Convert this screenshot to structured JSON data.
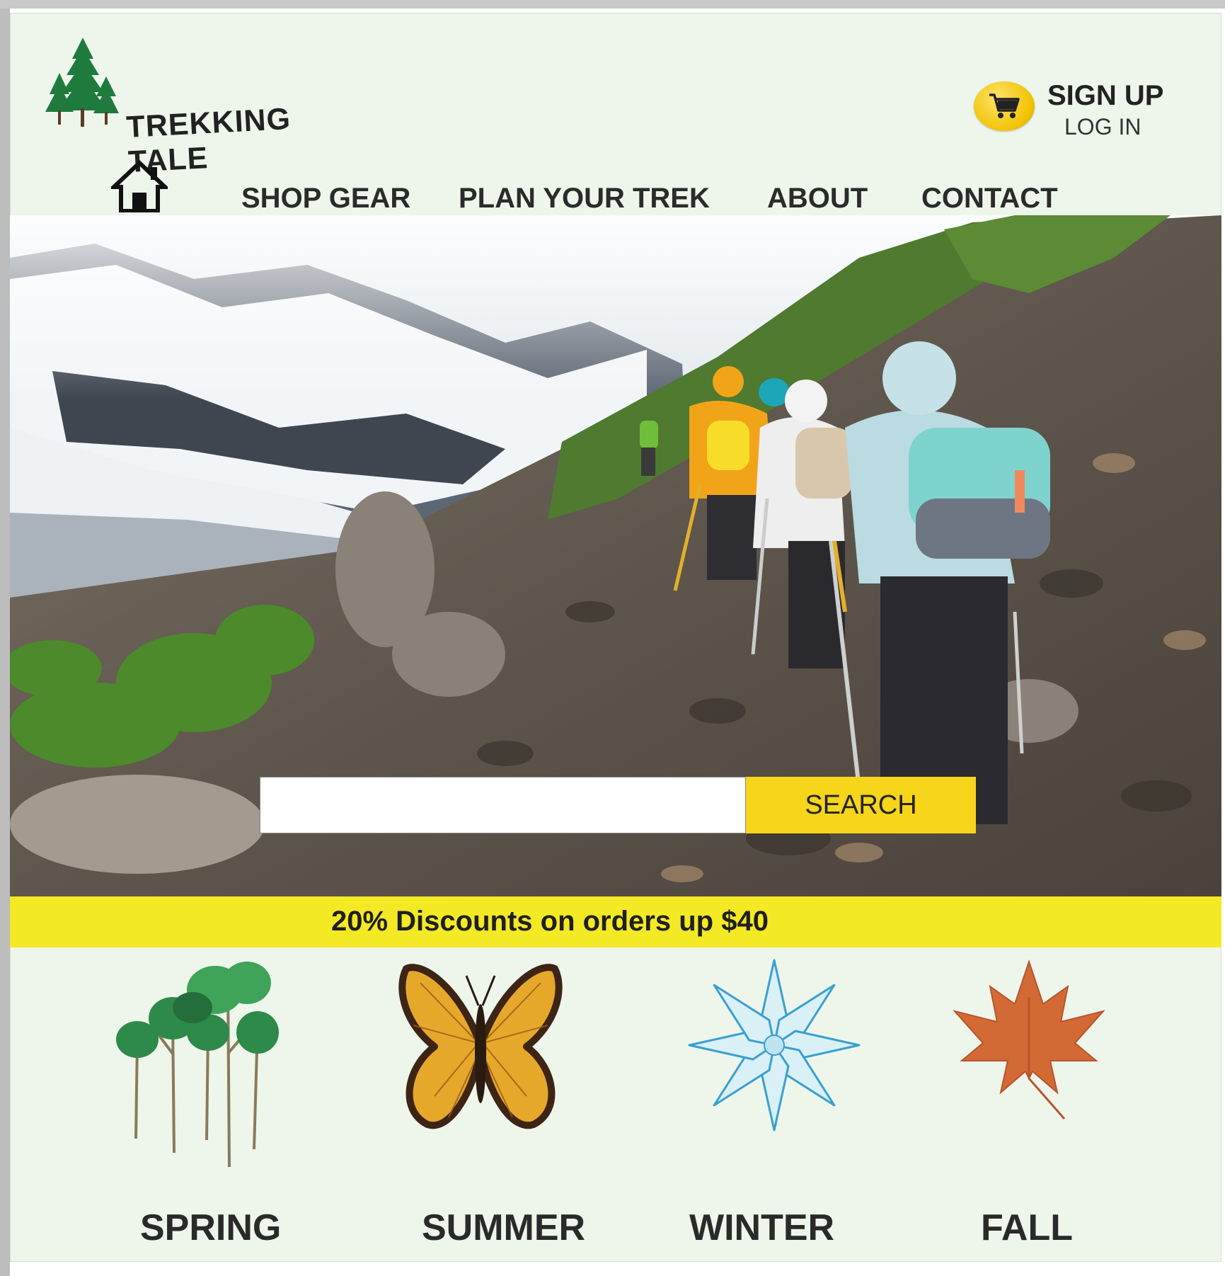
{
  "brand": {
    "name": "TREKKING TALE"
  },
  "account": {
    "sign_up": "SIGN UP",
    "log_in": "LOG IN"
  },
  "nav": {
    "items": [
      {
        "label": "SHOP GEAR"
      },
      {
        "label": "PLAN YOUR TREK"
      },
      {
        "label": "ABOUT"
      },
      {
        "label": "CONTACT"
      }
    ]
  },
  "search": {
    "placeholder": "",
    "button_label": "SEARCH"
  },
  "promo": {
    "text": "20% Discounts on orders up $40"
  },
  "seasons": [
    {
      "label": "SPRING",
      "icon": "trees-icon"
    },
    {
      "label": "SUMMER",
      "icon": "butterfly-icon"
    },
    {
      "label": "WINTER",
      "icon": "snowflake-icon"
    },
    {
      "label": "FALL",
      "icon": "maple-leaf-icon"
    }
  ],
  "colors": {
    "page_bg": "#eef6ec",
    "promo_bg": "#f3e924",
    "search_button": "#f7d51a",
    "cart_button": "#f0c200",
    "text": "#222222"
  }
}
